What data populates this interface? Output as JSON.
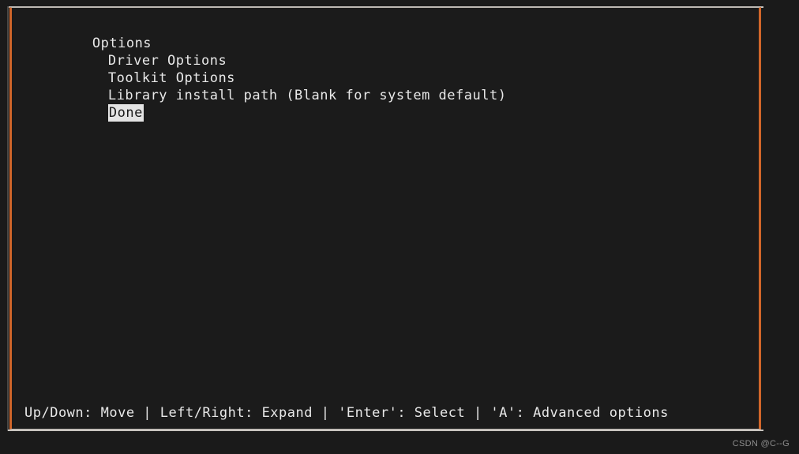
{
  "colors": {
    "terminal_background": "#1a1a1a",
    "panel_background": "#1b1b1b",
    "panel_border_side": "#d1662a",
    "panel_border_topbottom": "#b9b4ae",
    "frame_line": "#c9c5c0",
    "text": "#e8e8e8",
    "selected_background": "#e4e4e4",
    "selected_text": "#1b1b1b",
    "watermark": "#8d8d8d"
  },
  "menu": {
    "items": [
      {
        "label": "Options",
        "indent": 0,
        "selected": false
      },
      {
        "label": "Driver Options",
        "indent": 1,
        "selected": false
      },
      {
        "label": "Toolkit Options",
        "indent": 1,
        "selected": false
      },
      {
        "label": "Library install path (Blank for system default)",
        "indent": 1,
        "selected": false
      },
      {
        "label": "Done",
        "indent": 1,
        "selected": true
      }
    ]
  },
  "statusbar": {
    "text": "Up/Down: Move | Left/Right: Expand | 'Enter': Select | 'A': Advanced options"
  },
  "watermark": {
    "text": "CSDN @C--G"
  }
}
